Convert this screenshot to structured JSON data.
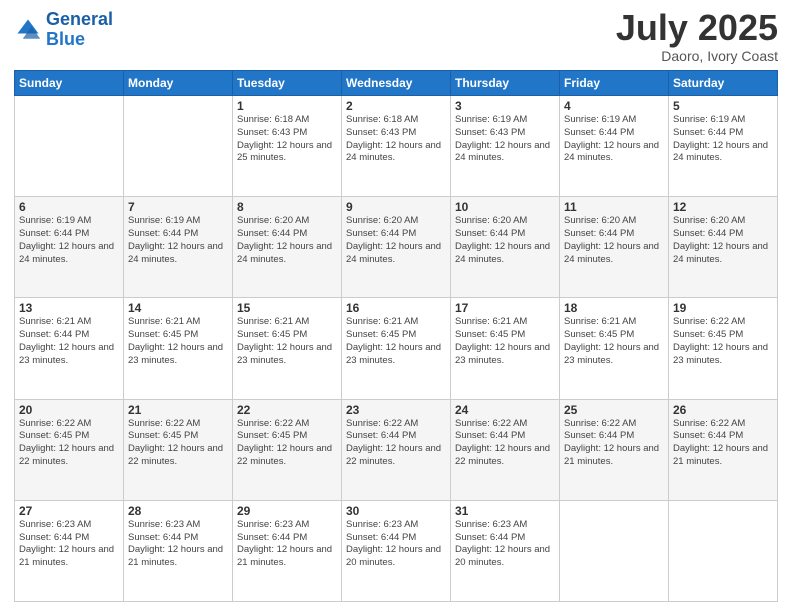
{
  "header": {
    "logo_line1": "General",
    "logo_line2": "Blue",
    "month": "July 2025",
    "location": "Daoro, Ivory Coast"
  },
  "weekdays": [
    "Sunday",
    "Monday",
    "Tuesday",
    "Wednesday",
    "Thursday",
    "Friday",
    "Saturday"
  ],
  "weeks": [
    [
      {
        "day": "",
        "info": ""
      },
      {
        "day": "",
        "info": ""
      },
      {
        "day": "1",
        "info": "Sunrise: 6:18 AM\nSunset: 6:43 PM\nDaylight: 12 hours and 25 minutes."
      },
      {
        "day": "2",
        "info": "Sunrise: 6:18 AM\nSunset: 6:43 PM\nDaylight: 12 hours and 24 minutes."
      },
      {
        "day": "3",
        "info": "Sunrise: 6:19 AM\nSunset: 6:43 PM\nDaylight: 12 hours and 24 minutes."
      },
      {
        "day": "4",
        "info": "Sunrise: 6:19 AM\nSunset: 6:44 PM\nDaylight: 12 hours and 24 minutes."
      },
      {
        "day": "5",
        "info": "Sunrise: 6:19 AM\nSunset: 6:44 PM\nDaylight: 12 hours and 24 minutes."
      }
    ],
    [
      {
        "day": "6",
        "info": "Sunrise: 6:19 AM\nSunset: 6:44 PM\nDaylight: 12 hours and 24 minutes."
      },
      {
        "day": "7",
        "info": "Sunrise: 6:19 AM\nSunset: 6:44 PM\nDaylight: 12 hours and 24 minutes."
      },
      {
        "day": "8",
        "info": "Sunrise: 6:20 AM\nSunset: 6:44 PM\nDaylight: 12 hours and 24 minutes."
      },
      {
        "day": "9",
        "info": "Sunrise: 6:20 AM\nSunset: 6:44 PM\nDaylight: 12 hours and 24 minutes."
      },
      {
        "day": "10",
        "info": "Sunrise: 6:20 AM\nSunset: 6:44 PM\nDaylight: 12 hours and 24 minutes."
      },
      {
        "day": "11",
        "info": "Sunrise: 6:20 AM\nSunset: 6:44 PM\nDaylight: 12 hours and 24 minutes."
      },
      {
        "day": "12",
        "info": "Sunrise: 6:20 AM\nSunset: 6:44 PM\nDaylight: 12 hours and 24 minutes."
      }
    ],
    [
      {
        "day": "13",
        "info": "Sunrise: 6:21 AM\nSunset: 6:44 PM\nDaylight: 12 hours and 23 minutes."
      },
      {
        "day": "14",
        "info": "Sunrise: 6:21 AM\nSunset: 6:45 PM\nDaylight: 12 hours and 23 minutes."
      },
      {
        "day": "15",
        "info": "Sunrise: 6:21 AM\nSunset: 6:45 PM\nDaylight: 12 hours and 23 minutes."
      },
      {
        "day": "16",
        "info": "Sunrise: 6:21 AM\nSunset: 6:45 PM\nDaylight: 12 hours and 23 minutes."
      },
      {
        "day": "17",
        "info": "Sunrise: 6:21 AM\nSunset: 6:45 PM\nDaylight: 12 hours and 23 minutes."
      },
      {
        "day": "18",
        "info": "Sunrise: 6:21 AM\nSunset: 6:45 PM\nDaylight: 12 hours and 23 minutes."
      },
      {
        "day": "19",
        "info": "Sunrise: 6:22 AM\nSunset: 6:45 PM\nDaylight: 12 hours and 23 minutes."
      }
    ],
    [
      {
        "day": "20",
        "info": "Sunrise: 6:22 AM\nSunset: 6:45 PM\nDaylight: 12 hours and 22 minutes."
      },
      {
        "day": "21",
        "info": "Sunrise: 6:22 AM\nSunset: 6:45 PM\nDaylight: 12 hours and 22 minutes."
      },
      {
        "day": "22",
        "info": "Sunrise: 6:22 AM\nSunset: 6:45 PM\nDaylight: 12 hours and 22 minutes."
      },
      {
        "day": "23",
        "info": "Sunrise: 6:22 AM\nSunset: 6:44 PM\nDaylight: 12 hours and 22 minutes."
      },
      {
        "day": "24",
        "info": "Sunrise: 6:22 AM\nSunset: 6:44 PM\nDaylight: 12 hours and 22 minutes."
      },
      {
        "day": "25",
        "info": "Sunrise: 6:22 AM\nSunset: 6:44 PM\nDaylight: 12 hours and 21 minutes."
      },
      {
        "day": "26",
        "info": "Sunrise: 6:22 AM\nSunset: 6:44 PM\nDaylight: 12 hours and 21 minutes."
      }
    ],
    [
      {
        "day": "27",
        "info": "Sunrise: 6:23 AM\nSunset: 6:44 PM\nDaylight: 12 hours and 21 minutes."
      },
      {
        "day": "28",
        "info": "Sunrise: 6:23 AM\nSunset: 6:44 PM\nDaylight: 12 hours and 21 minutes."
      },
      {
        "day": "29",
        "info": "Sunrise: 6:23 AM\nSunset: 6:44 PM\nDaylight: 12 hours and 21 minutes."
      },
      {
        "day": "30",
        "info": "Sunrise: 6:23 AM\nSunset: 6:44 PM\nDaylight: 12 hours and 20 minutes."
      },
      {
        "day": "31",
        "info": "Sunrise: 6:23 AM\nSunset: 6:44 PM\nDaylight: 12 hours and 20 minutes."
      },
      {
        "day": "",
        "info": ""
      },
      {
        "day": "",
        "info": ""
      }
    ]
  ]
}
